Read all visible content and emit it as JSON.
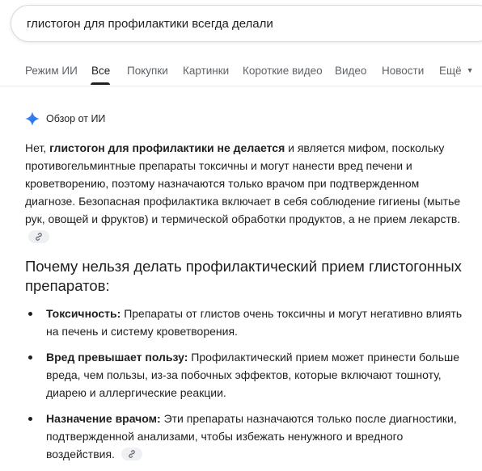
{
  "search": {
    "query": "глистогон для профилактики всегда делали"
  },
  "tabs": [
    {
      "label": "Режим ИИ"
    },
    {
      "label": "Все"
    },
    {
      "label": "Покупки"
    },
    {
      "label": "Картинки"
    },
    {
      "label": "Короткие видео"
    },
    {
      "label": "Видео"
    },
    {
      "label": "Новости"
    },
    {
      "label": "Ещё"
    }
  ],
  "active_tab": "Все",
  "ai_overview": {
    "label": "Обзор от ИИ",
    "summary_pre": "Нет, ",
    "summary_bold": "глистогон для профилактики не делается",
    "summary_post": " и является мифом, поскольку противогельминтные препараты токсичны и могут нанести вред печени и кроветворению, поэтому назначаются только врачом при подтвержденном диагнозе. Безопасная профилактика включает в себя соблюдение гигиены (мытье рук, овощей и фруктов) и термической обработки продуктов, а не прием лекарств.",
    "heading": "Почему нельзя делать профилактический прием глистогонных препаратов:",
    "bullets": [
      {
        "title": "Токсичность:",
        "text": " Препараты от глистов очень токсичны и могут негативно влиять на печень и систему кроветворения."
      },
      {
        "title": "Вред превышает пользу:",
        "text": " Профилактический прием может принести больше вреда, чем пользы, из-за побочных эффектов, которые включают тошноту, диарею и аллергические реакции."
      },
      {
        "title": "Назначение врачом:",
        "text": " Эти препараты назначаются только после диагностики, подтвержденной анализами, чтобы избежать ненужного и вредного воздействия."
      }
    ]
  },
  "icons": {
    "sparkle": "gemini-sparkle-icon",
    "link": "link-icon",
    "more_caret": "caret-down-icon"
  },
  "colors": {
    "sparkle": "#4285f4",
    "text": "#1f1f1f",
    "tab_inactive": "#5f6368"
  }
}
